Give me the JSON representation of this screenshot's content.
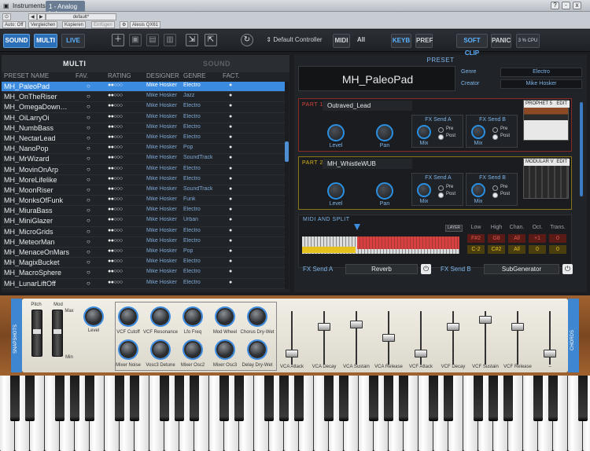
{
  "titlebar": {
    "app_label": "Instruments",
    "tab": "1 - Analog Lab",
    "buttons": [
      "?",
      "-",
      "x"
    ]
  },
  "host": {
    "preset_dropdown": "default*",
    "auto": "Auto: Off",
    "compare": "Vergleichen",
    "copy": "Kopieren",
    "paste": "Einfügen",
    "device": "Alesis QX61"
  },
  "toolbar": {
    "sound": "SOUND",
    "multi": "MULTI",
    "live": "LIVE",
    "controller": "Default Controller",
    "midi": "MIDI",
    "all": "All",
    "keys": "KEYB",
    "pref": "PREF",
    "softclip": "SOFT CLIP",
    "panic": "PANIC",
    "cpu": "3 % CPU"
  },
  "browser": {
    "mode_multi": "MULTI",
    "mode_sound": "SOUND",
    "columns": [
      "PRESET NAME",
      "FAV.",
      "RATING",
      "DESIGNER",
      "GENRE",
      "FACT."
    ],
    "rows": [
      {
        "name": "MH_PaleoPad",
        "fav": "○",
        "rating": "●●○○○",
        "designer": "Mike Hosker",
        "genre": "Electro",
        "fact": "●"
      },
      {
        "name": "MH_OnTheRiser",
        "fav": "○",
        "rating": "●●○○○",
        "designer": "Mike Hosker",
        "genre": "Jazz",
        "fact": "●"
      },
      {
        "name": "MH_OmegaDown…",
        "fav": "○",
        "rating": "●●○○○",
        "designer": "Mike Hosker",
        "genre": "Electro",
        "fact": "●"
      },
      {
        "name": "MH_OiLarryOi",
        "fav": "○",
        "rating": "●●○○○",
        "designer": "Mike Hosker",
        "genre": "Electro",
        "fact": "●"
      },
      {
        "name": "MH_NumbBass",
        "fav": "○",
        "rating": "●●○○○",
        "designer": "Mike Hosker",
        "genre": "Electro",
        "fact": "●"
      },
      {
        "name": "MH_NectarLead",
        "fav": "○",
        "rating": "●●○○○",
        "designer": "Mike Hosker",
        "genre": "Electro",
        "fact": "●"
      },
      {
        "name": "MH_NanoPop",
        "fav": "○",
        "rating": "●●○○○",
        "designer": "Mike Hosker",
        "genre": "Pop",
        "fact": "●"
      },
      {
        "name": "MH_MrWizard",
        "fav": "○",
        "rating": "●●○○○",
        "designer": "Mike Hosker",
        "genre": "SoundTrack",
        "fact": "●"
      },
      {
        "name": "MH_MovinOnArp",
        "fav": "○",
        "rating": "●●○○○",
        "designer": "Mike Hosker",
        "genre": "Electro",
        "fact": "●"
      },
      {
        "name": "MH_MoreLifelike",
        "fav": "○",
        "rating": "●●○○○",
        "designer": "Mike Hosker",
        "genre": "Electro",
        "fact": "●"
      },
      {
        "name": "MH_MoonRiser",
        "fav": "○",
        "rating": "●●○○○",
        "designer": "Mike Hosker",
        "genre": "SoundTrack",
        "fact": "●"
      },
      {
        "name": "MH_MonksOfFunk",
        "fav": "○",
        "rating": "●●○○○",
        "designer": "Mike Hosker",
        "genre": "Funk",
        "fact": "●"
      },
      {
        "name": "MH_MiuraBass",
        "fav": "○",
        "rating": "●●○○○",
        "designer": "Mike Hosker",
        "genre": "Electro",
        "fact": "●"
      },
      {
        "name": "MH_MiniGlazer",
        "fav": "○",
        "rating": "●●○○○",
        "designer": "Mike Hosker",
        "genre": "Urban",
        "fact": "●"
      },
      {
        "name": "MH_MicroGrids",
        "fav": "○",
        "rating": "●●○○○",
        "designer": "Mike Hosker",
        "genre": "Electro",
        "fact": "●"
      },
      {
        "name": "MH_MeteorMan",
        "fav": "○",
        "rating": "●●○○○",
        "designer": "Mike Hosker",
        "genre": "Electro",
        "fact": "●"
      },
      {
        "name": "MH_MenaceOnMars",
        "fav": "○",
        "rating": "●●○○○",
        "designer": "Mike Hosker",
        "genre": "Pop",
        "fact": "●"
      },
      {
        "name": "MH_MagixBucket",
        "fav": "○",
        "rating": "●●○○○",
        "designer": "Mike Hosker",
        "genre": "Electro",
        "fact": "●"
      },
      {
        "name": "MH_MacroSphere",
        "fav": "○",
        "rating": "●●○○○",
        "designer": "Mike Hosker",
        "genre": "Electro",
        "fact": "●"
      },
      {
        "name": "MH_LunarLiftOff",
        "fav": "○",
        "rating": "●●○○○",
        "designer": "Mike Hosker",
        "genre": "Electro",
        "fact": "●"
      }
    ]
  },
  "preset": {
    "header": "PRESET",
    "name": "MH_PaleoPad",
    "genre_label": "Genre",
    "genre": "Electro",
    "creator_label": "Creator",
    "creator": "Mike Hosker"
  },
  "part1": {
    "tag": "PART 1",
    "name": "Outraved_Lead",
    "instrument": "PROPHET 5",
    "edit": "EDIT",
    "level": "Level",
    "pan": "Pan",
    "fxA": "FX Send A",
    "fxB": "FX Send B",
    "mix": "Mix",
    "pre": "Pre",
    "post": "Post",
    "color": "#c83a2e"
  },
  "part2": {
    "tag": "PART 2",
    "name": "MH_WhistleWUB",
    "instrument": "MODULAR V",
    "edit": "EDIT",
    "level": "Level",
    "pan": "Pan",
    "fxA": "FX Send A",
    "fxB": "FX Send B",
    "mix": "Mix",
    "pre": "Pre",
    "post": "Post",
    "color": "#d6b21c"
  },
  "midisplit": {
    "title": "MIDI AND SPLIT",
    "layer": "LAYER",
    "headers": [
      "Low",
      "High",
      "Chan.",
      "Oct.",
      "Trans."
    ],
    "row1": [
      "F#2",
      "G8",
      "All",
      "+1",
      "0"
    ],
    "row2": [
      "C-2",
      "C#2",
      "All",
      "0",
      "0"
    ]
  },
  "fx": {
    "a_label": "FX Send A",
    "a_value": "Reverb",
    "b_label": "FX Send B",
    "b_value": "SubGenerator"
  },
  "synth": {
    "snapshots": "SNAPSHOTS",
    "chords": "CHORDS",
    "pitch": "Pitch",
    "mod": "Mod",
    "max": "Max",
    "min": "Min",
    "level": "Level",
    "knobs_top": [
      "VCF Cutoff",
      "VCF Resonance",
      "Lfo Freq",
      "Mod Wheel",
      "Chorus Dry-Wet"
    ],
    "knobs_bottom": [
      "Mixer Noise",
      "Vosc3 Detune",
      "Mixer Osc2",
      "Mixer Osc3",
      "Delay Dry-Wet"
    ],
    "faders": [
      "VCA Attack",
      "VCA Decay",
      "VCA Sustain",
      "VCA Release",
      "VCF Attack",
      "VCF Decay",
      "VCF Sustain",
      "VCF Release",
      "–"
    ],
    "fader_levels": [
      0.15,
      0.75,
      0.8,
      0.5,
      0.15,
      0.75,
      0.9,
      0.75,
      0.15
    ]
  },
  "colors": {
    "accent": "#3b8be0",
    "selected_row": "#3b8be0",
    "wood": "#8b5226"
  }
}
